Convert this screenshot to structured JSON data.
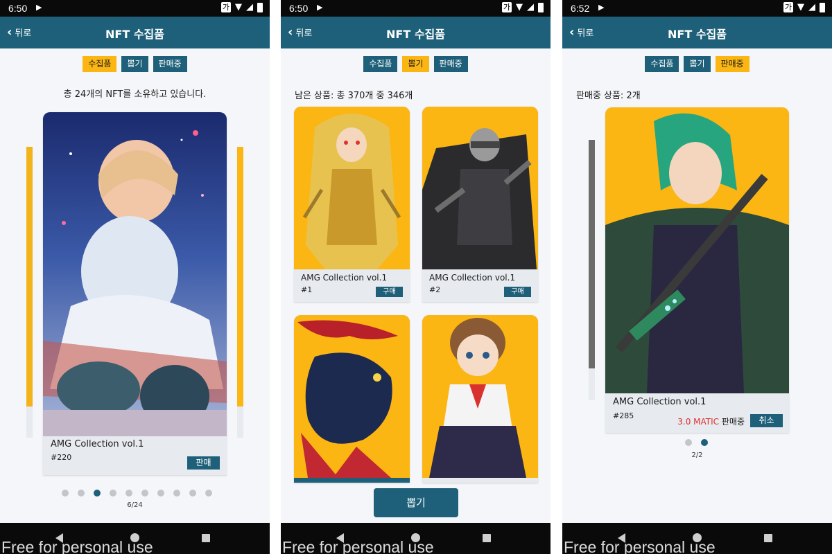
{
  "status": {
    "glyph_ga": "가"
  },
  "screens": [
    {
      "time": "6:50",
      "back_label": "뒤로",
      "title": "NFT 수집품",
      "tabs": [
        "수집품",
        "뽑기",
        "판매중"
      ],
      "active_tab": 0,
      "info": "총 24개의 NFT를 소유하고 있습니다.",
      "card": {
        "name": "AMG Collection vol.1",
        "number": "#220",
        "button": "판매"
      },
      "pager": "6/24",
      "dots": 10,
      "active_dot": 2
    },
    {
      "time": "6:50",
      "back_label": "뒤로",
      "title": "NFT 수집품",
      "tabs": [
        "수집품",
        "뽑기",
        "판매중"
      ],
      "active_tab": 1,
      "info": "남은 상품: 총 370개 중 346개",
      "cards": [
        {
          "name": "AMG Collection vol.1",
          "number": "#1",
          "button": "구매"
        },
        {
          "name": "AMG Collection vol.1",
          "number": "#2",
          "button": "구매"
        }
      ],
      "draw_button": "뽑기"
    },
    {
      "time": "6:52",
      "back_label": "뒤로",
      "title": "NFT 수집품",
      "tabs": [
        "수집품",
        "뽑기",
        "판매중"
      ],
      "active_tab": 2,
      "info": "판매중 상품: 2개",
      "card": {
        "name": "AMG Collection vol.1",
        "number": "#285",
        "price": "3.0 MATIC",
        "status": "판매중",
        "button": "취소"
      },
      "pager": "2/2",
      "dots": 2,
      "active_dot": 1
    }
  ],
  "watermark": "Free for personal use",
  "colors": {
    "accent": "#1e6079",
    "active_tab": "#fbb613",
    "card_art_bg": "#fbb613",
    "price": "#e0312e"
  },
  "icons": [
    "back-chevron-icon",
    "play-store-icon",
    "wifi-icon",
    "signal-icon",
    "battery-icon",
    "nav-back-icon",
    "nav-home-icon",
    "nav-recents-icon"
  ]
}
